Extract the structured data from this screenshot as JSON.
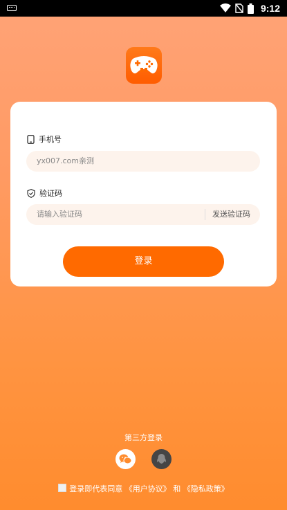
{
  "status_bar": {
    "time": "9:12",
    "icons": [
      "keyboard-icon",
      "wifi-icon",
      "no-sim-icon",
      "battery-icon"
    ]
  },
  "app_icon": "gamepad-logo",
  "login_form": {
    "phone_label": "手机号",
    "phone_value": "yx007.com亲测",
    "code_label": "验证码",
    "code_placeholder": "请输入验证码",
    "send_code_label": "发送验证码",
    "login_button": "登录"
  },
  "third_party": {
    "title": "第三方登录",
    "providers": [
      "wechat-icon",
      "qq-icon"
    ]
  },
  "agreement": {
    "prefix": "登录即代表同意",
    "user_agreement": "《用户协议》",
    "conjunction": "和",
    "privacy_policy": "《隐私政策》"
  },
  "colors": {
    "accent": "#ff6a00",
    "input_background": "#fdf3ec",
    "background_top": "#ffa377",
    "background_bottom": "#ff8c2e"
  }
}
